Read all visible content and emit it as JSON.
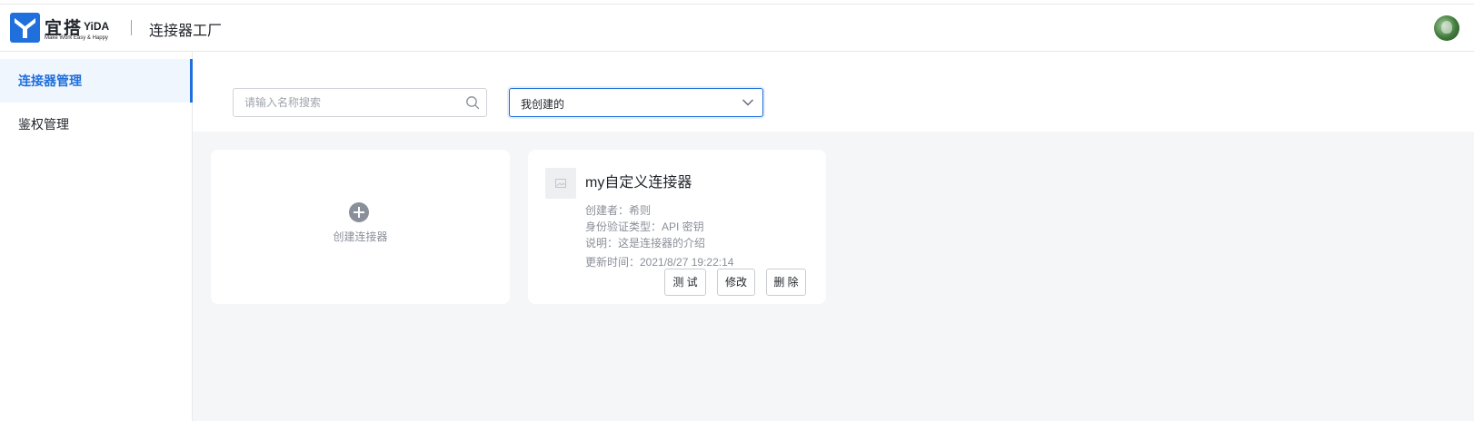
{
  "header": {
    "logo_cn": "宜搭",
    "logo_en": "YiDA",
    "logo_tagline": "Make Work Easy & Happy",
    "app_title": "连接器工厂",
    "brand_color": "#1f6fdc"
  },
  "sidebar": {
    "items": [
      {
        "label": "连接器管理",
        "active": true
      },
      {
        "label": "鉴权管理",
        "active": false
      }
    ]
  },
  "filters": {
    "search_placeholder": "请输入名称搜索",
    "search_value": "",
    "select_value": "我创建的"
  },
  "create_card": {
    "label": "创建连接器",
    "icon": "plus-circle-icon"
  },
  "connectors": [
    {
      "name": "my自定义连接器",
      "creator": "创建者：希则",
      "auth_type": "身份验证类型：API 密钥",
      "description": "说明：这是连接器的介绍",
      "updated": "更新时间：2021/8/27 19:22:14",
      "actions": {
        "test": "测 试",
        "edit": "修改",
        "delete": "删 除"
      },
      "icon": "image-placeholder-icon"
    }
  ],
  "icons": {
    "search": "search-icon",
    "select": "chevron-down-icon",
    "user": "avatar"
  }
}
